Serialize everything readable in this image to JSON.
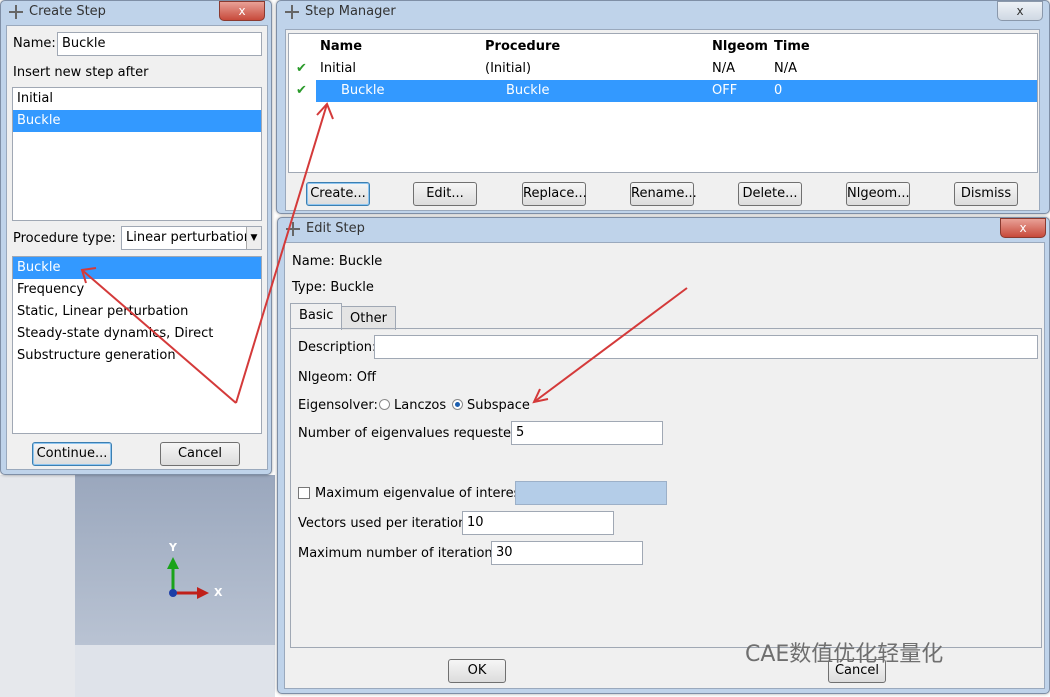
{
  "create_step": {
    "title": "Create Step",
    "close_label": "x",
    "name_label": "Name:",
    "name_value": "Buckle",
    "insert_after_label": "Insert new step after",
    "insert_items": [
      "Initial",
      "Buckle"
    ],
    "procedure_type_label": "Procedure type:",
    "procedure_type_value": "Linear perturbation",
    "procedures": [
      "Buckle",
      "Frequency",
      "Static, Linear perturbation",
      "Steady-state dynamics, Direct",
      "Substructure generation"
    ],
    "continue_label": "Continue...",
    "cancel_label": "Cancel"
  },
  "step_manager": {
    "title": "Step Manager",
    "close_label": "x",
    "columns": [
      "Name",
      "Procedure",
      "Nlgeom",
      "Time"
    ],
    "rows": [
      {
        "name": "Initial",
        "procedure": "(Initial)",
        "nlgeom": "N/A",
        "time": "N/A"
      },
      {
        "name": "Buckle",
        "procedure": "Buckle",
        "nlgeom": "OFF",
        "time": "0"
      }
    ],
    "buttons": [
      "Create...",
      "Edit...",
      "Replace...",
      "Rename...",
      "Delete...",
      "Nlgeom...",
      "Dismiss"
    ]
  },
  "edit_step": {
    "title": "Edit Step",
    "close_label": "x",
    "name_line": "Name:  Buckle",
    "type_line": "Type:  Buckle",
    "tabs": [
      "Basic",
      "Other"
    ],
    "description_label": "Description:",
    "description_value": "",
    "nlgeom_line": "Nlgeom:  Off",
    "eigensolver_label": "Eigensolver:",
    "eigensolver_options": [
      "Lanczos",
      "Subspace"
    ],
    "eigensolver_selected": "Subspace",
    "num_eigen_label": "Number of eigenvalues requested:",
    "num_eigen_value": "5",
    "max_eigen_label": "Maximum eigenvalue of interest:",
    "max_eigen_value": "",
    "vectors_label": "Vectors used per iteration:",
    "vectors_value": "10",
    "max_iter_label": "Maximum number of iterations:",
    "max_iter_value": "30",
    "ok_label": "OK",
    "cancel_label": "Cancel"
  },
  "viewport": {
    "axis_y": "Y",
    "axis_x": "X"
  },
  "watermark": "CAE数值优化轻量化"
}
